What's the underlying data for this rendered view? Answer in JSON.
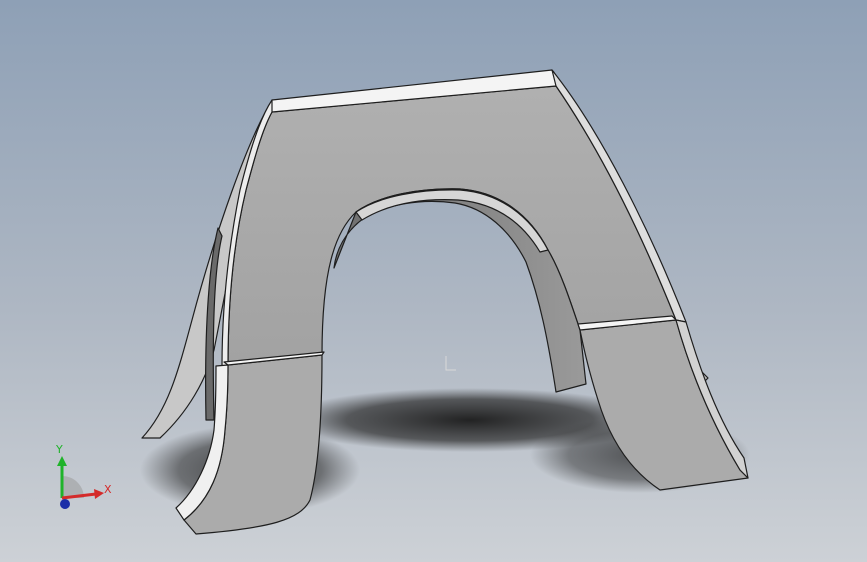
{
  "viewport": {
    "background_top": "#8ea0b6",
    "background_mid": "#aeb7c3",
    "background_bottom": "#cdd1d6"
  },
  "model": {
    "face_color": "#a9a9a9",
    "face_highlight": "#f4f4f4",
    "edge_color": "#1e1e1e",
    "shadow_color": "#2a2a2a"
  },
  "triad": {
    "x_label": "X",
    "y_label": "Y",
    "x_color": "#d42a2a",
    "y_color": "#1fb32a",
    "z_color": "#1c2fa8"
  }
}
